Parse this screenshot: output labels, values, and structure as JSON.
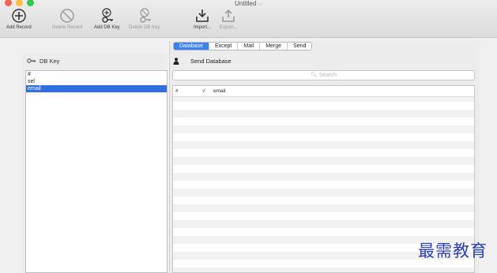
{
  "window": {
    "title": "Untitled"
  },
  "toolbar": {
    "add_record": "Add Record",
    "delete_record": "Delete Record",
    "add_db_key": "Add DB Key",
    "delete_db_key": "Delete DB Key",
    "import": "Import...",
    "export": "Export..."
  },
  "left": {
    "header": "DB Key",
    "keys": [
      "#",
      "sel",
      "email"
    ],
    "selected_index": 2
  },
  "right": {
    "tabs": [
      "Database",
      "Except",
      "Mail",
      "Merge",
      "Send"
    ],
    "active_tab": "Database",
    "send_label": "Send Database",
    "search_placeholder": "Search",
    "grid_columns": [
      "#",
      "√",
      "email"
    ]
  },
  "colors": {
    "selection": "#2f6fde",
    "active_tab": "#3b82f0"
  },
  "watermark": "最需教育"
}
